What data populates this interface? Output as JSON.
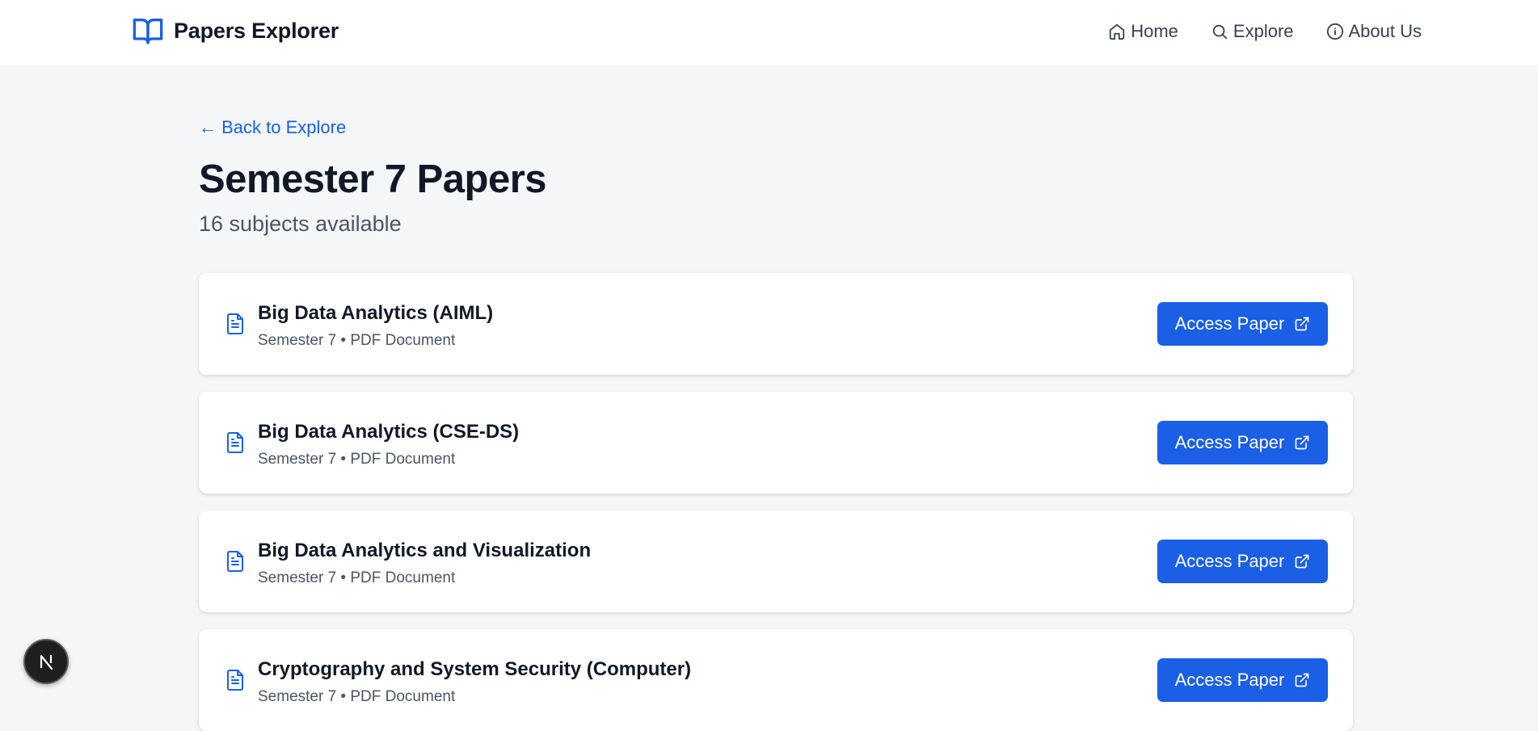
{
  "header": {
    "brand_name": "Papers Explorer",
    "brand_icon": "book-open-icon",
    "nav": [
      {
        "label": "Home",
        "icon": "home-icon"
      },
      {
        "label": "Explore",
        "icon": "search-icon"
      },
      {
        "label": "About Us",
        "icon": "info-icon"
      }
    ]
  },
  "main": {
    "back_link": "← Back to Explore",
    "title": "Semester 7 Papers",
    "subtitle": "16 subjects available",
    "papers": [
      {
        "title": "Big Data Analytics (AIML)",
        "meta": "Semester 7 • PDF Document",
        "button": "Access Paper"
      },
      {
        "title": "Big Data Analytics (CSE-DS)",
        "meta": "Semester 7 • PDF Document",
        "button": "Access Paper"
      },
      {
        "title": "Big Data Analytics and Visualization",
        "meta": "Semester 7 • PDF Document",
        "button": "Access Paper"
      },
      {
        "title": "Cryptography and System Security (Computer)",
        "meta": "Semester 7 • PDF Document",
        "button": "Access Paper"
      }
    ]
  },
  "colors": {
    "accent": "#1a5fe6",
    "page_background": "#f4f6f8",
    "card_background": "#ffffff",
    "title_text": "#111827",
    "muted_text": "#4b5563"
  },
  "dev_badge": {
    "icon": "nextjs-logo-icon"
  }
}
